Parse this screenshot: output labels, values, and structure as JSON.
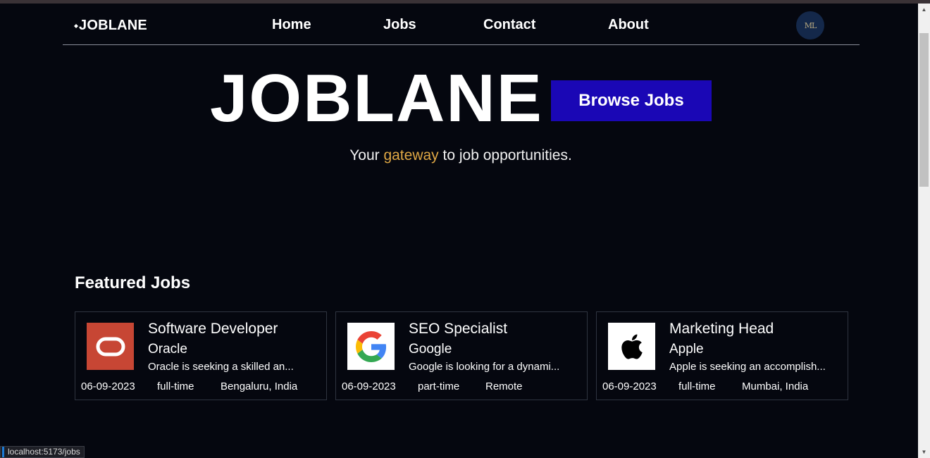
{
  "nav": {
    "brand": "JOBLANE",
    "links": [
      "Home",
      "Jobs",
      "Contact",
      "About"
    ],
    "avatar_initials": "ML"
  },
  "hero": {
    "title": "JOBLANE",
    "browse_button": "Browse Jobs",
    "tagline_prefix": "Your ",
    "tagline_accent": "gateway",
    "tagline_suffix": " to job opportunities.",
    "accent_color": "#e0a845",
    "button_color": "#1a07b5"
  },
  "featured": {
    "heading": "Featured Jobs",
    "jobs": [
      {
        "title": "Software Developer",
        "company": "Oracle",
        "description": "Oracle is seeking a skilled an...",
        "date": "06-09-2023",
        "type": "full-time",
        "location": "Bengaluru, India",
        "logo_icon": "oracle-logo-icon"
      },
      {
        "title": "SEO Specialist",
        "company": "Google",
        "description": "Google is looking for a dynami...",
        "date": "06-09-2023",
        "type": "part-time",
        "location": "Remote",
        "logo_icon": "google-logo-icon"
      },
      {
        "title": "Marketing Head",
        "company": "Apple",
        "description": "Apple is seeking an accomplish...",
        "date": "06-09-2023",
        "type": "full-time",
        "location": "Mumbai, India",
        "logo_icon": "apple-logo-icon"
      }
    ]
  },
  "status_bar": {
    "url": "localhost:5173/jobs"
  }
}
